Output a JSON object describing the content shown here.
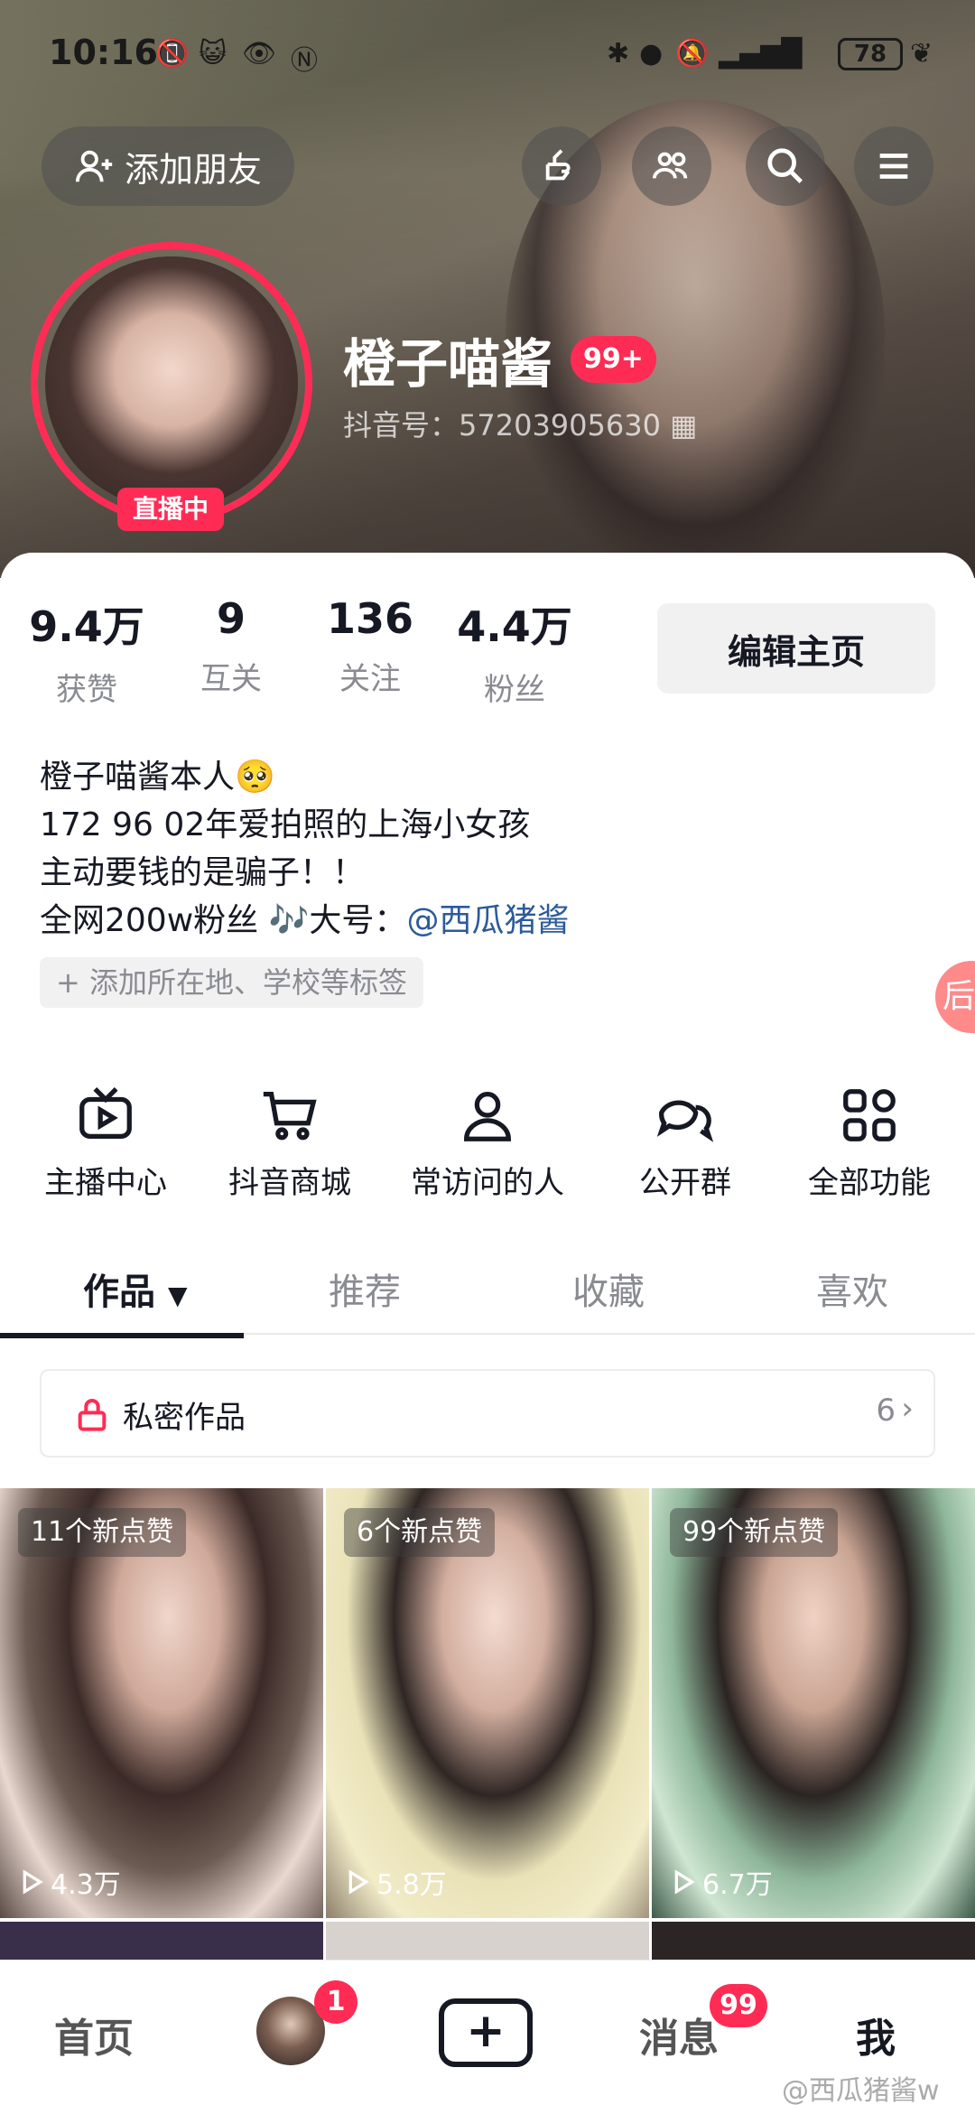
{
  "status_bar": {
    "time": "10:16",
    "battery": "78"
  },
  "header": {
    "add_friend_label": "添加朋友"
  },
  "profile": {
    "nickname": "橙子喵酱",
    "nickname_badge": "99+",
    "douyin_id": "抖音号：57203905630",
    "live_badge": "直播中"
  },
  "stats": [
    {
      "value": "9.4万",
      "label": "获赞"
    },
    {
      "value": "9",
      "label": "互关"
    },
    {
      "value": "136",
      "label": "关注"
    },
    {
      "value": "4.4万",
      "label": "粉丝"
    }
  ],
  "edit_profile_label": "编辑主页",
  "bio": {
    "line1": "橙子喵酱本人🥺",
    "line2": "172 96 02年爱拍照的上海小女孩",
    "line3": "主动要钱的是骗子！！",
    "line4_prefix": "全网200w粉丝 🎶大号：",
    "line4_mention": "@西瓜猪酱"
  },
  "add_tag_label": "+ 添加所在地、学校等标签",
  "float_button_label": "后",
  "quick_actions": [
    {
      "label": "主播中心",
      "icon": "tv-play-icon"
    },
    {
      "label": "抖音商城",
      "icon": "cart-icon"
    },
    {
      "label": "常访问的人",
      "icon": "person-icon"
    },
    {
      "label": "公开群",
      "icon": "chat-group-icon"
    },
    {
      "label": "全部功能",
      "icon": "grid-icon"
    }
  ],
  "tabs": [
    {
      "label": "作品",
      "active": true
    },
    {
      "label": "推荐"
    },
    {
      "label": "收藏"
    },
    {
      "label": "喜欢"
    }
  ],
  "private_works": {
    "label": "私密作品",
    "count": "6"
  },
  "videos": [
    {
      "likes_badge": "11个新点赞",
      "plays": "4.3万"
    },
    {
      "likes_badge": "6个新点赞",
      "plays": "5.8万"
    },
    {
      "likes_badge": "99个新点赞",
      "plays": "6.7万"
    }
  ],
  "bottom_nav": {
    "home": "首页",
    "friend_badge": "1",
    "messages": "消息",
    "messages_badge": "99",
    "me": "我"
  },
  "watermark": "@西瓜猪酱w",
  "colors": {
    "accent": "#fe2c55",
    "mention": "#2d5a9b",
    "text": "#161823",
    "muted": "#8a8b91"
  }
}
